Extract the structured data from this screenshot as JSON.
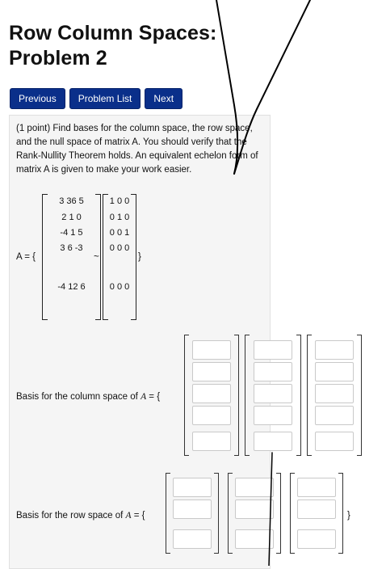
{
  "page": {
    "title_line1": "Row Column Spaces:",
    "title_line2": "Problem 2"
  },
  "nav": {
    "previous": "Previous",
    "problem_list": "Problem List",
    "next": "Next"
  },
  "problem": {
    "text": "(1 point) Find bases for the column space, the row space, and the null space of matrix A. You should verify that the Rank-Nullity Theorem holds. An equivalent echelon form of matrix A is given to make your work easier.",
    "a_label": "A = {",
    "tilde": "~",
    "close_brace": "}",
    "matrix_a_rows": [
      "3 36 5",
      "2 1 0",
      "-4 1 5",
      "3 6 -3",
      "-4 12 6"
    ],
    "echelon_rows": [
      "1 0 0",
      "0 1 0",
      "0 0 1",
      "0 0 0",
      "0 0 0"
    ]
  },
  "column_space": {
    "label_prefix": "Basis for the column space of ",
    "label_var": "A",
    "label_suffix": " = {"
  },
  "row_space": {
    "label_prefix": "Basis for the row space of ",
    "label_var": "A",
    "label_suffix": " = {",
    "close_brace": "}"
  }
}
